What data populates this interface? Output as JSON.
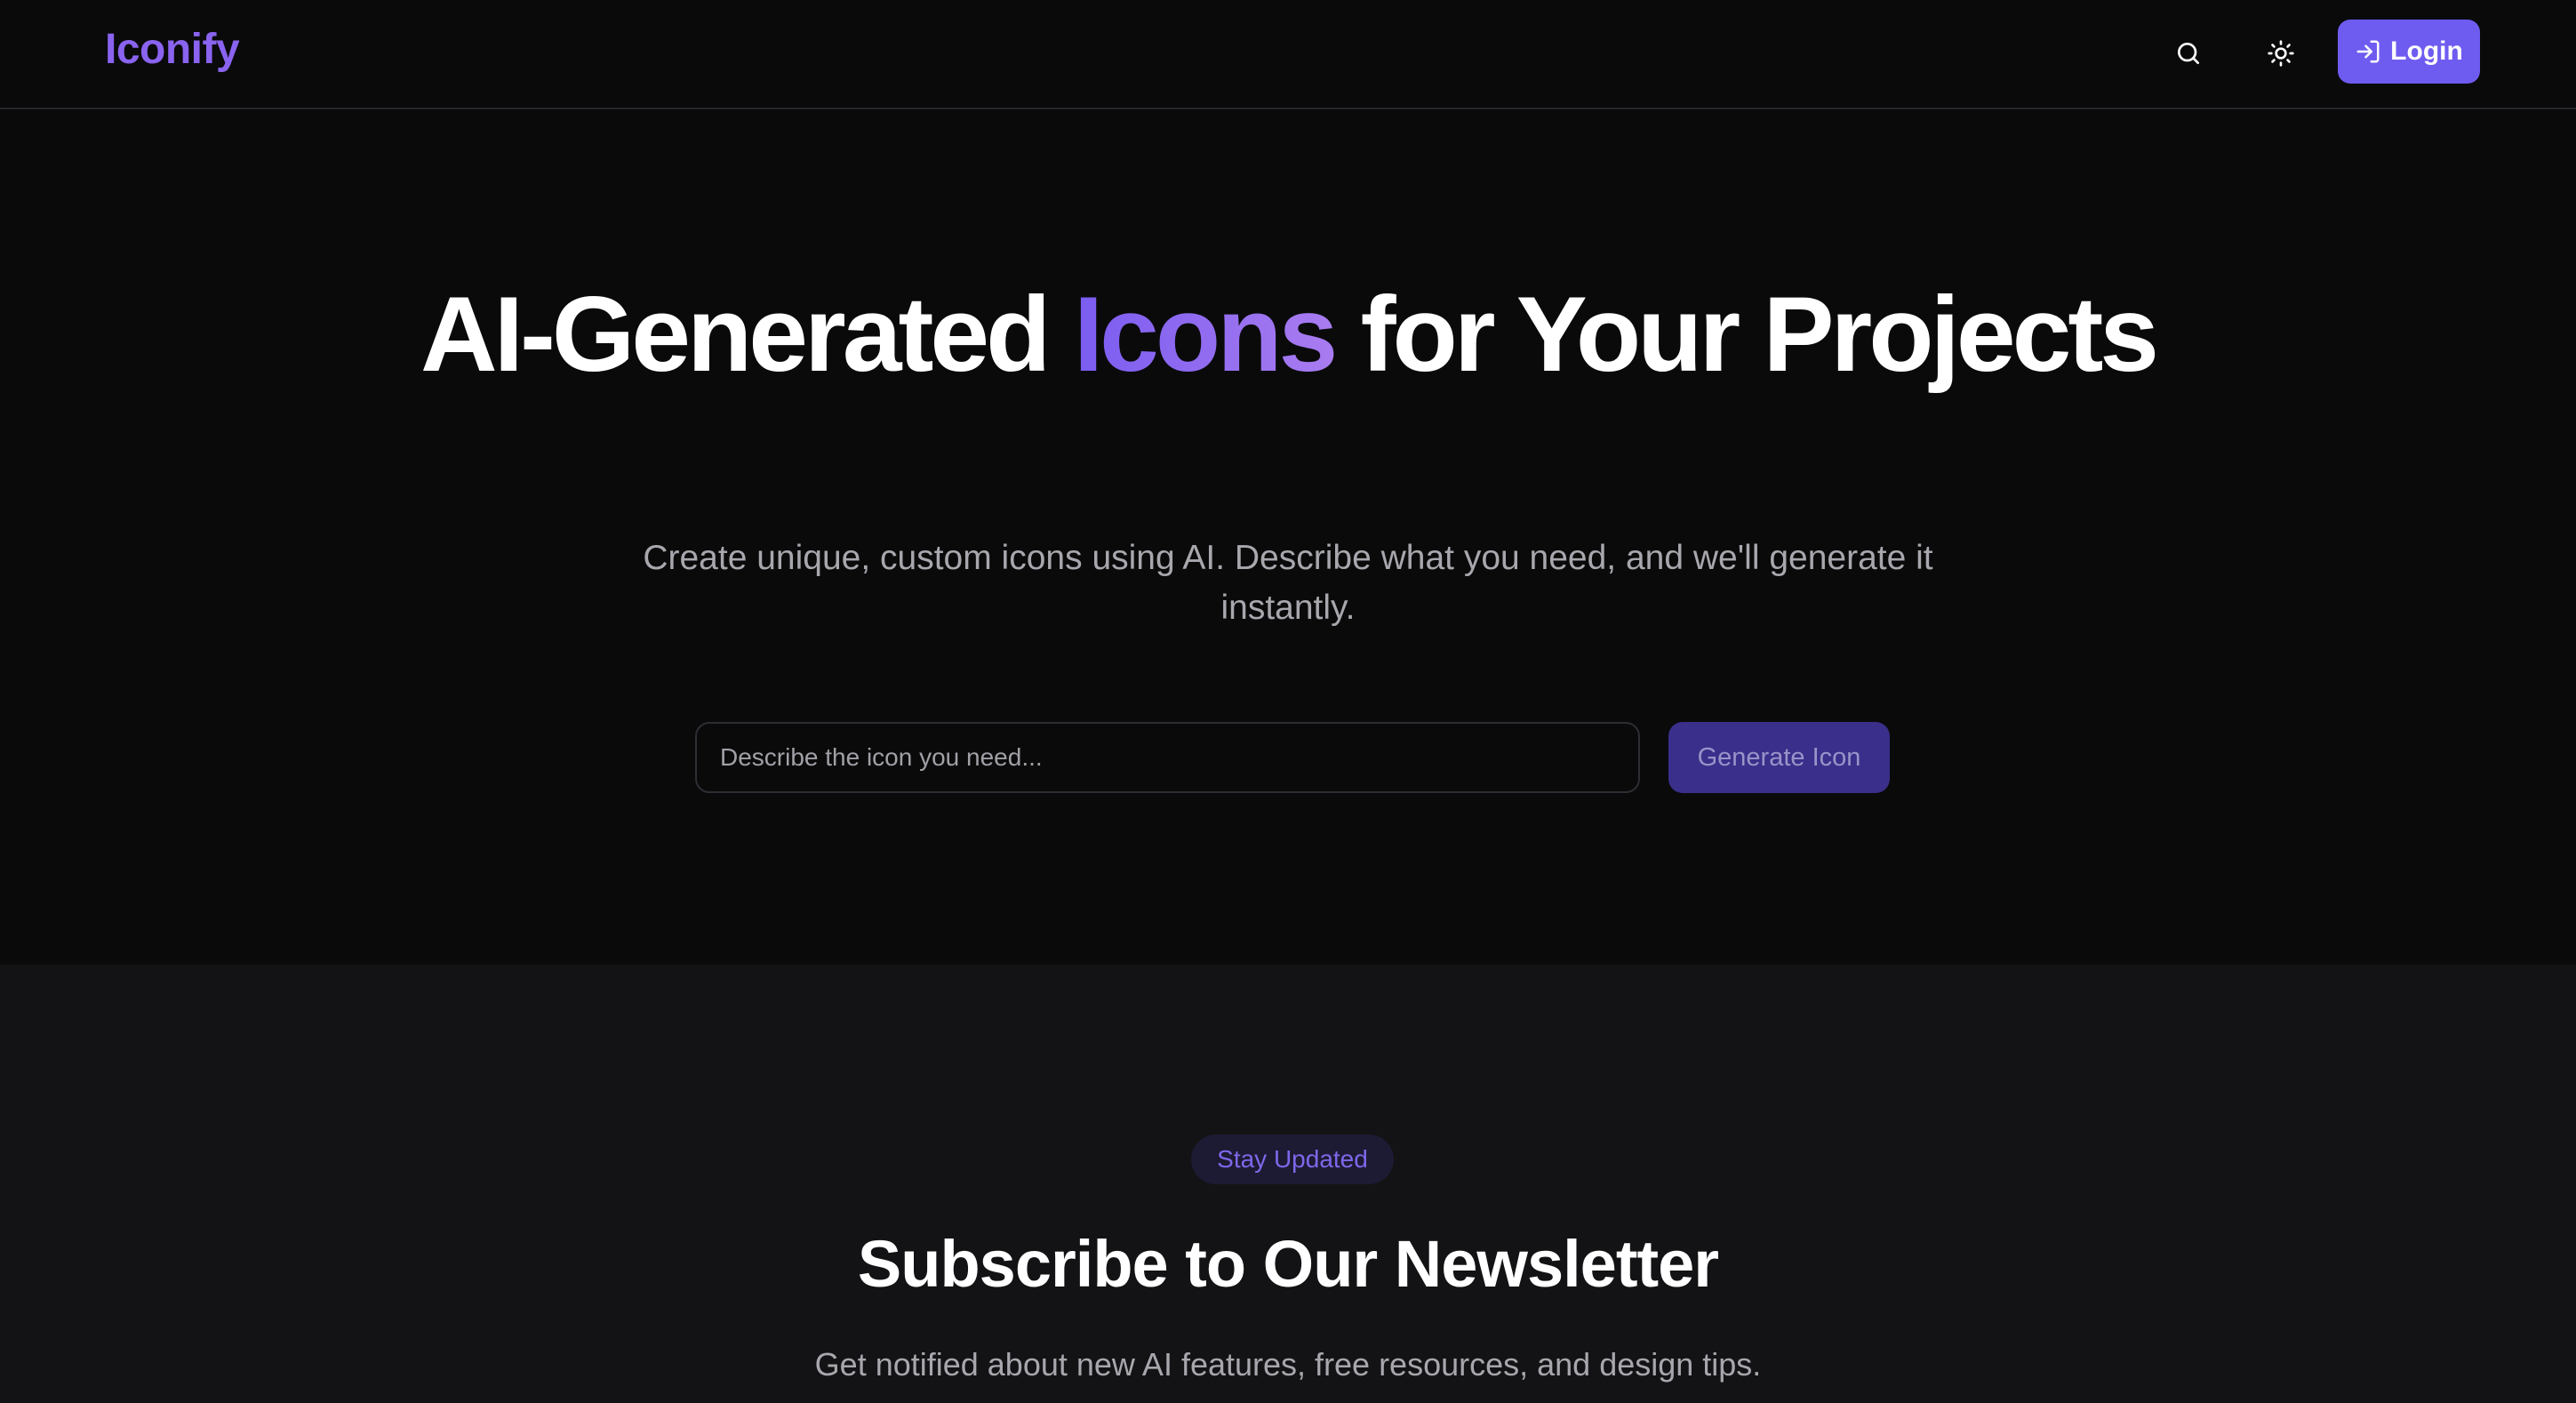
{
  "header": {
    "logo": "Iconify",
    "search_icon": "search-icon",
    "theme_icon": "sun-icon",
    "login_icon": "login-icon",
    "login_label": "Login"
  },
  "hero": {
    "title_part1": "AI-Generated ",
    "title_accent": "Icons",
    "title_part2": " for Your Projects",
    "subtitle": "Create unique, custom icons using AI. Describe what you need, and we'll generate it instantly.",
    "input_placeholder": "Describe the icon you need...",
    "input_value": "",
    "generate_label": "Generate Icon"
  },
  "newsletter": {
    "badge": "Stay Updated",
    "title": "Subscribe to Our Newsletter",
    "subtitle": "Get notified about new AI features, free resources, and design tips."
  },
  "colors": {
    "background": "#0a0a0b",
    "section_background": "#131315",
    "accent": "#6e5cf0",
    "logo": "#8a63f0",
    "muted_text": "#a7a7ad"
  }
}
